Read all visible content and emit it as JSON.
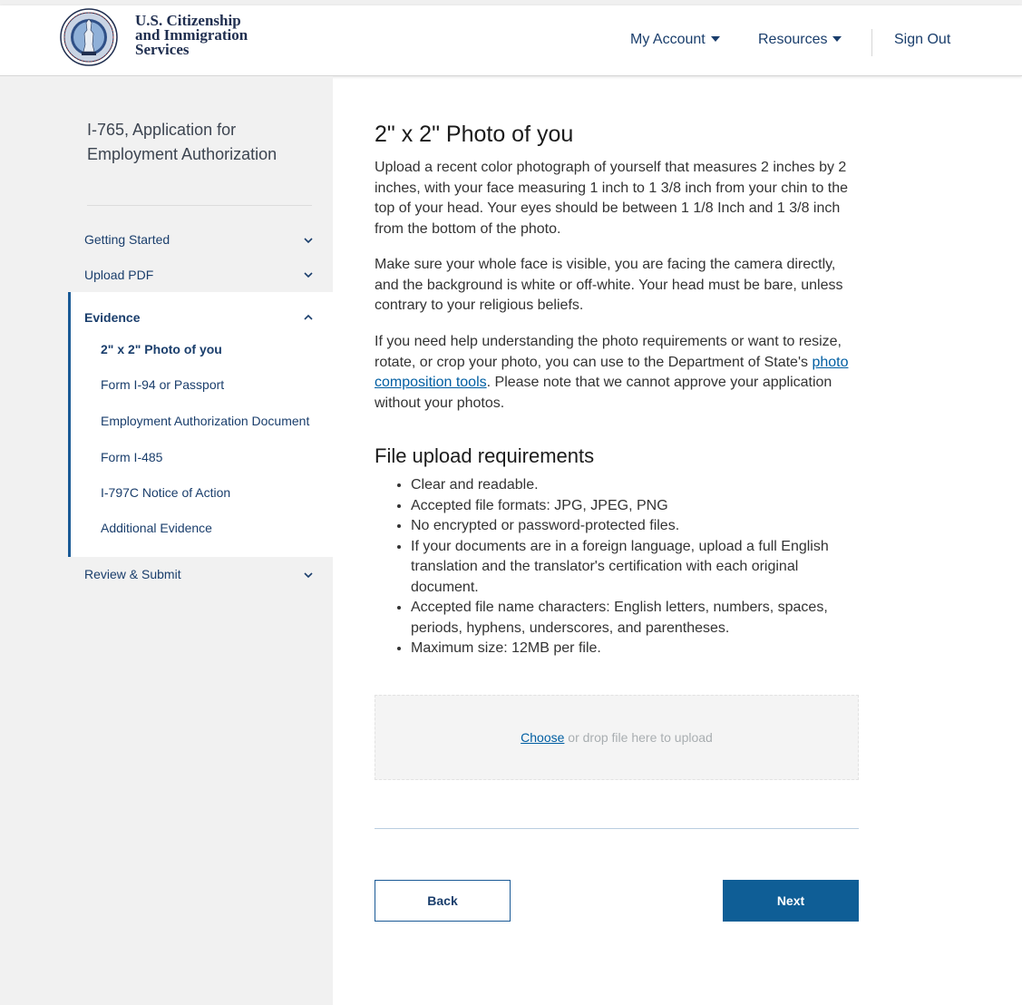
{
  "header": {
    "agency_name": [
      "U.S. Citizenship",
      "and Immigration",
      "Services"
    ],
    "nav": {
      "my_account": "My Account",
      "resources": "Resources",
      "sign_out": "Sign Out"
    }
  },
  "sidebar": {
    "app_title": "I-765, Application for Employment Authorization",
    "sections": {
      "getting_started": "Getting Started",
      "upload_pdf": "Upload PDF",
      "evidence": "Evidence",
      "review_submit": "Review & Submit"
    },
    "evidence_items": [
      "2\" x 2\" Photo of you",
      "Form I-94 or Passport",
      "Employment Authorization Document",
      "Form I-485",
      "I-797C Notice of Action",
      "Additional Evidence"
    ],
    "active_item": "2\" x 2\" Photo of you"
  },
  "main": {
    "title": "2\" x 2\" Photo of you",
    "para1": "Upload a recent color photograph of yourself that measures 2 inches by 2 inches, with your face measuring 1 inch to 1 3/8 inch from your chin to the top of your head. Your eyes should be between 1 1/8 Inch and 1 3/8 inch from the bottom of the photo.",
    "para2": "Make sure your whole face is visible, you are facing the camera directly, and the background is white or off-white. Your head must be bare, unless contrary to your religious beliefs.",
    "para3_before": "If you need help understanding the photo requirements or want to resize, rotate, or crop your photo, you can use to the Department of State's ",
    "para3_link": "photo composition tools",
    "para3_after": ". Please note that we cannot approve your application without your photos.",
    "requirements_title": "File upload requirements",
    "requirements": [
      "Clear and readable.",
      "Accepted file formats: JPG, JPEG, PNG",
      "No encrypted or password-protected files.",
      "If your documents are in a foreign language, upload a full English translation and the translator's certification with each original document.",
      "Accepted file name characters: English letters, numbers, spaces, periods, hyphens, underscores, and parentheses.",
      "Maximum size: 12MB per file."
    ],
    "dropzone": {
      "choose": "Choose",
      "text": " or drop file here to upload"
    },
    "buttons": {
      "back": "Back",
      "next": "Next"
    }
  },
  "colors": {
    "brand_navy": "#1a3e6c",
    "primary_button": "#0f5e96",
    "link": "#005ea2",
    "sidebar_bg": "#f1f1f1"
  }
}
